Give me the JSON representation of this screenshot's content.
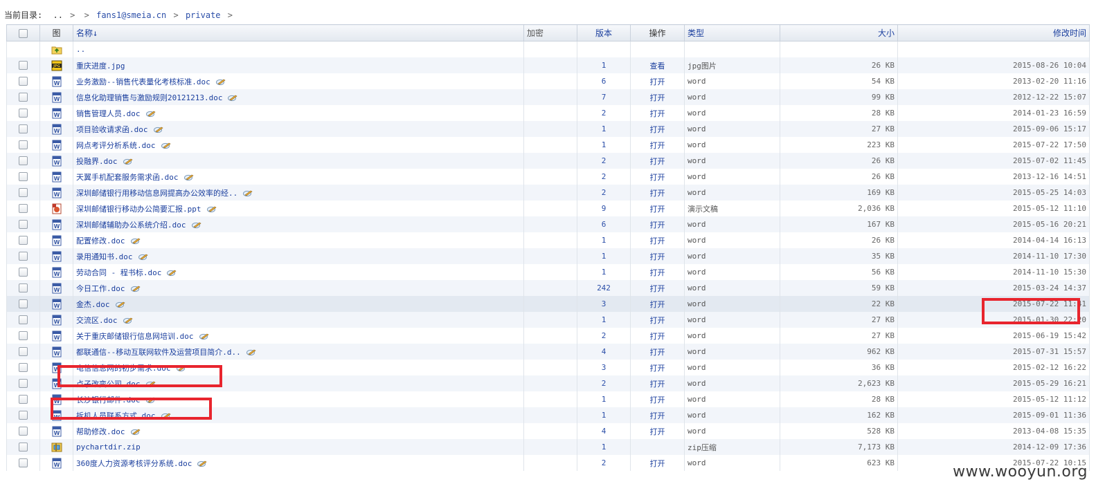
{
  "breadcrumb": {
    "label": "当前目录:",
    "items": [
      "..",
      ">",
      ">",
      "fans1@smeia.cn",
      ">",
      "private",
      ">"
    ]
  },
  "table": {
    "headers": {
      "icon": "图",
      "name": "名称↓",
      "encrypt": "加密",
      "version": "版本",
      "action": "操作",
      "type": "类型",
      "size": "大小",
      "mtime": "修改时间"
    },
    "parent_row": {
      "name": ".."
    },
    "rows": [
      {
        "name": "重庆进度.jpg",
        "icon": "jpg-file-icon",
        "version": "1",
        "action": "查看",
        "type": "jpg图片",
        "size": "26 KB",
        "mtime": "2015-08-26 10:04",
        "edit": false
      },
      {
        "name": "业务激励--销售代表量化考核标准.doc",
        "icon": "word-file-icon",
        "version": "6",
        "action": "打开",
        "type": "word",
        "size": "54 KB",
        "mtime": "2013-02-20 11:16",
        "edit": true
      },
      {
        "name": "信息化助理销售与激励规则20121213.doc",
        "icon": "word-file-icon",
        "version": "7",
        "action": "打开",
        "type": "word",
        "size": "99 KB",
        "mtime": "2012-12-22 15:07",
        "edit": true
      },
      {
        "name": "销售管理人员.doc",
        "icon": "word-file-icon",
        "version": "2",
        "action": "打开",
        "type": "word",
        "size": "28 KB",
        "mtime": "2014-01-23 16:59",
        "edit": true
      },
      {
        "name": "项目验收请求函.doc",
        "icon": "word-file-icon",
        "version": "1",
        "action": "打开",
        "type": "word",
        "size": "27 KB",
        "mtime": "2015-09-06 15:17",
        "edit": true
      },
      {
        "name": "网点考评分析系统.doc",
        "icon": "word-file-icon",
        "version": "1",
        "action": "打开",
        "type": "word",
        "size": "223 KB",
        "mtime": "2015-07-22 17:50",
        "edit": true
      },
      {
        "name": "投融界.doc",
        "icon": "word-file-icon",
        "version": "2",
        "action": "打开",
        "type": "word",
        "size": "26 KB",
        "mtime": "2015-07-02 11:45",
        "edit": true
      },
      {
        "name": "天翼手机配套服务需求函.doc",
        "icon": "word-file-icon",
        "version": "2",
        "action": "打开",
        "type": "word",
        "size": "26 KB",
        "mtime": "2013-12-16 14:51",
        "edit": true
      },
      {
        "name": "深圳邮储银行用移动信息网提高办公效率的经..",
        "icon": "word-file-icon",
        "version": "2",
        "action": "打开",
        "type": "word",
        "size": "169 KB",
        "mtime": "2015-05-25 14:03",
        "edit": true
      },
      {
        "name": "深圳邮储银行移动办公简要汇报.ppt",
        "icon": "ppt-file-icon",
        "version": "9",
        "action": "打开",
        "type": "演示文稿",
        "size": "2,036 KB",
        "mtime": "2015-05-12 11:10",
        "edit": true
      },
      {
        "name": "深圳邮储辅助办公系统介绍.doc",
        "icon": "word-file-icon",
        "version": "6",
        "action": "打开",
        "type": "word",
        "size": "167 KB",
        "mtime": "2015-05-16 20:21",
        "edit": true
      },
      {
        "name": "配置修改.doc",
        "icon": "word-file-icon",
        "version": "1",
        "action": "打开",
        "type": "word",
        "size": "26 KB",
        "mtime": "2014-04-14 16:13",
        "edit": true
      },
      {
        "name": "录用通知书.doc",
        "icon": "word-file-icon",
        "version": "1",
        "action": "打开",
        "type": "word",
        "size": "35 KB",
        "mtime": "2014-11-10 17:30",
        "edit": true
      },
      {
        "name": "劳动合同 - 程书标.doc",
        "icon": "word-file-icon",
        "version": "1",
        "action": "打开",
        "type": "word",
        "size": "56 KB",
        "mtime": "2014-11-10 15:30",
        "edit": true
      },
      {
        "name": "今日工作.doc",
        "icon": "word-file-icon",
        "version": "242",
        "action": "打开",
        "type": "word",
        "size": "59 KB",
        "mtime": "2015-03-24 14:37",
        "edit": true
      },
      {
        "name": "金杰.doc",
        "icon": "word-file-icon",
        "version": "3",
        "action": "打开",
        "type": "word",
        "size": "22 KB",
        "mtime": "2015-07-22 11:41",
        "edit": true,
        "highlight": true
      },
      {
        "name": "交流区.doc",
        "icon": "word-file-icon",
        "version": "1",
        "action": "打开",
        "type": "word",
        "size": "27 KB",
        "mtime": "2015-01-30 22:20",
        "edit": true
      },
      {
        "name": "关于重庆邮储银行信息网培训.doc",
        "icon": "word-file-icon",
        "version": "2",
        "action": "打开",
        "type": "word",
        "size": "27 KB",
        "mtime": "2015-06-19 15:42",
        "edit": true
      },
      {
        "name": "都联通信--移动互联网软件及运营项目简介.d..",
        "icon": "word-file-icon",
        "version": "4",
        "action": "打开",
        "type": "word",
        "size": "962 KB",
        "mtime": "2015-07-31 15:57",
        "edit": true
      },
      {
        "name": "电信信息网的初步需求.doc",
        "icon": "word-file-icon",
        "version": "3",
        "action": "打开",
        "type": "word",
        "size": "36 KB",
        "mtime": "2015-02-12 16:22",
        "edit": true
      },
      {
        "name": "点子改变公司.doc",
        "icon": "word-file-icon",
        "version": "2",
        "action": "打开",
        "type": "word",
        "size": "2,623 KB",
        "mtime": "2015-05-29 16:21",
        "edit": true
      },
      {
        "name": "长沙银行邮件.doc",
        "icon": "word-file-icon",
        "version": "1",
        "action": "打开",
        "type": "word",
        "size": "28 KB",
        "mtime": "2015-05-12 11:12",
        "edit": true
      },
      {
        "name": "拆机人员联系方式.doc",
        "icon": "word-file-icon",
        "version": "1",
        "action": "打开",
        "type": "word",
        "size": "162 KB",
        "mtime": "2015-09-01 11:36",
        "edit": true
      },
      {
        "name": "帮助修改.doc",
        "icon": "word-file-icon",
        "version": "4",
        "action": "打开",
        "type": "word",
        "size": "528 KB",
        "mtime": "2013-04-08 15:35",
        "edit": true
      },
      {
        "name": "pychartdir.zip",
        "icon": "zip-file-icon",
        "version": "1",
        "action": "",
        "type": "zip压缩",
        "size": "7,173 KB",
        "mtime": "2014-12-09 17:36",
        "edit": false
      },
      {
        "name": "360度人力资源考核评分系统.doc",
        "icon": "word-file-icon",
        "version": "2",
        "action": "打开",
        "type": "word",
        "size": "623 KB",
        "mtime": "2015-07-22 10:15",
        "edit": true
      }
    ]
  },
  "watermark": "www.wooyun.org",
  "colors": {
    "link": "#1b3f9e",
    "annotation_red": "#e8252e",
    "row_alt": "#f2f5fa",
    "row_highlight": "#e3e9f1"
  }
}
